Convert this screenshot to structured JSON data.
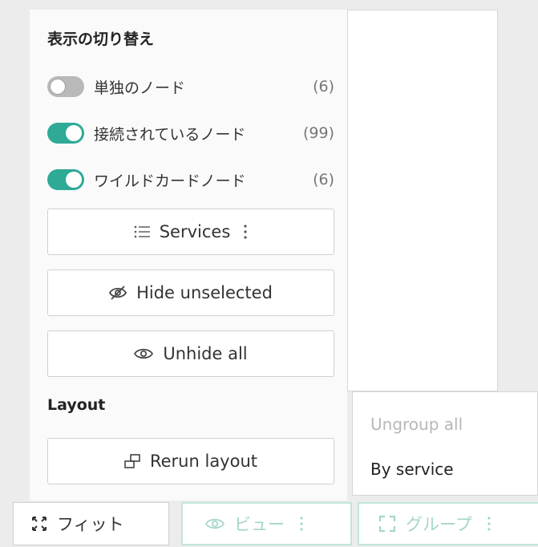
{
  "panel": {
    "title": "表示の切り替え",
    "toggles": [
      {
        "label": "単独のノード",
        "count": "(6)",
        "on": false
      },
      {
        "label": "接続されているノード",
        "count": "(99)",
        "on": true
      },
      {
        "label": "ワイルドカードノード",
        "count": "(6)",
        "on": true
      }
    ],
    "services_label": "Services",
    "hide_unselected_label": "Hide unselected",
    "unhide_all_label": "Unhide all",
    "layout_title": "Layout",
    "rerun_layout_label": "Rerun layout"
  },
  "group_menu": {
    "items": [
      {
        "label": "Ungroup all",
        "disabled": true
      },
      {
        "label": "By service",
        "disabled": false
      }
    ]
  },
  "toolbar": {
    "fit_label": "フィット",
    "view_label": "ビュー",
    "group_label": "グループ"
  },
  "colors": {
    "toggle_on": "#2eaa96",
    "toggle_off": "#b9b9b9",
    "accent_border": "#bfe6dd",
    "accent_text": "#a5d5ca"
  },
  "icons": {
    "services": "list-icon",
    "hide": "eye-slash-icon",
    "unhide": "eye-icon",
    "rerun": "layout-icon",
    "fit": "fit-arrows-icon",
    "view": "eye-icon",
    "group": "group-bracket-icon",
    "more": "more-vertical-icon"
  }
}
